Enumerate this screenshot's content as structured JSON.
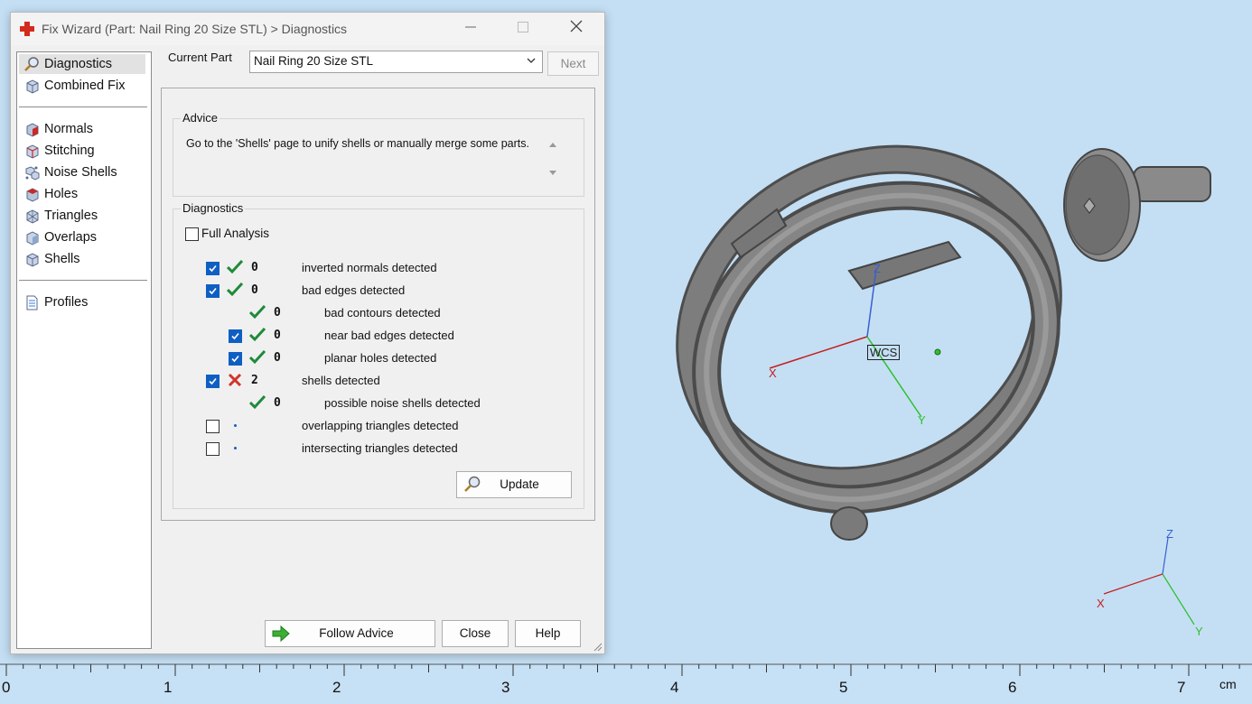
{
  "titlebar": {
    "title": "Fix Wizard (Part: Nail Ring 20 Size STL) > Diagnostics",
    "icons": [
      "red-cross-icon",
      "minimize-icon",
      "maximize-icon",
      "close-icon"
    ]
  },
  "nav": {
    "group1": [
      {
        "label": "Diagnostics",
        "icon": "magnifier-icon",
        "selected": true
      },
      {
        "label": "Combined Fix",
        "icon": "cube-icon",
        "selected": false
      }
    ],
    "group2": [
      {
        "label": "Normals",
        "icon": "normals-cube-icon"
      },
      {
        "label": "Stitching",
        "icon": "stitching-cube-icon"
      },
      {
        "label": "Noise Shells",
        "icon": "noise-shells-icon"
      },
      {
        "label": "Holes",
        "icon": "holes-cube-icon"
      },
      {
        "label": "Triangles",
        "icon": "triangles-cube-icon"
      },
      {
        "label": "Overlaps",
        "icon": "overlaps-cube-icon"
      },
      {
        "label": "Shells",
        "icon": "shells-cube-icon"
      }
    ],
    "group3": [
      {
        "label": "Profiles",
        "icon": "document-icon"
      }
    ]
  },
  "current_part": {
    "label": "Current Part",
    "value": "Nail Ring 20 Size STL",
    "next_label": "Next"
  },
  "advice": {
    "title": "Advice",
    "text": "Go to the 'Shells' page to unify shells or manually merge some parts."
  },
  "diagnostics": {
    "title": "Diagnostics",
    "full_analysis_label": "Full Analysis",
    "full_analysis_checked": false,
    "rows": [
      {
        "checked": true,
        "has_checkbox": true,
        "status": "ok",
        "count": "0",
        "label": "inverted normals detected",
        "indent": 0
      },
      {
        "checked": true,
        "has_checkbox": true,
        "status": "ok",
        "count": "0",
        "label": "bad edges detected",
        "indent": 0
      },
      {
        "checked": false,
        "has_checkbox": false,
        "status": "ok",
        "count": "0",
        "label": "bad contours detected",
        "indent": 1
      },
      {
        "checked": true,
        "has_checkbox": true,
        "status": "ok",
        "count": "0",
        "label": "near bad edges detected",
        "indent": 1
      },
      {
        "checked": true,
        "has_checkbox": true,
        "status": "ok",
        "count": "0",
        "label": "planar holes detected",
        "indent": 1
      },
      {
        "checked": true,
        "has_checkbox": true,
        "status": "error",
        "count": "2",
        "label": "shells detected",
        "indent": 0
      },
      {
        "checked": false,
        "has_checkbox": false,
        "status": "ok",
        "count": "0",
        "label": "possible noise shells detected",
        "indent": 1
      },
      {
        "checked": false,
        "has_checkbox": true,
        "status": "none",
        "count": "",
        "label": "overlapping triangles detected",
        "indent": 0
      },
      {
        "checked": false,
        "has_checkbox": true,
        "status": "none",
        "count": "",
        "label": "intersecting triangles detected",
        "indent": 0
      }
    ],
    "update_label": "Update"
  },
  "footer": {
    "follow_advice_label": "Follow Advice",
    "close_label": "Close",
    "help_label": "Help"
  },
  "viewport": {
    "wcs_label": "WCS",
    "axes": {
      "x": "X",
      "y": "Y",
      "z": "Z"
    },
    "small_axes": {
      "x": "X",
      "y": "Y",
      "z": "Z"
    }
  },
  "ruler": {
    "ticks": [
      "0",
      "1",
      "2",
      "3",
      "4",
      "5",
      "6",
      "7"
    ],
    "unit": "cm"
  },
  "colors": {
    "viewport_bg": "#c4dff4",
    "checkbox_blue": "#0f5fc3",
    "ok_green": "#1f8a3a",
    "error_red": "#d0352b",
    "axis_x": "#c41e1e",
    "axis_y": "#2fbf2f",
    "axis_z": "#3a5fd0"
  }
}
